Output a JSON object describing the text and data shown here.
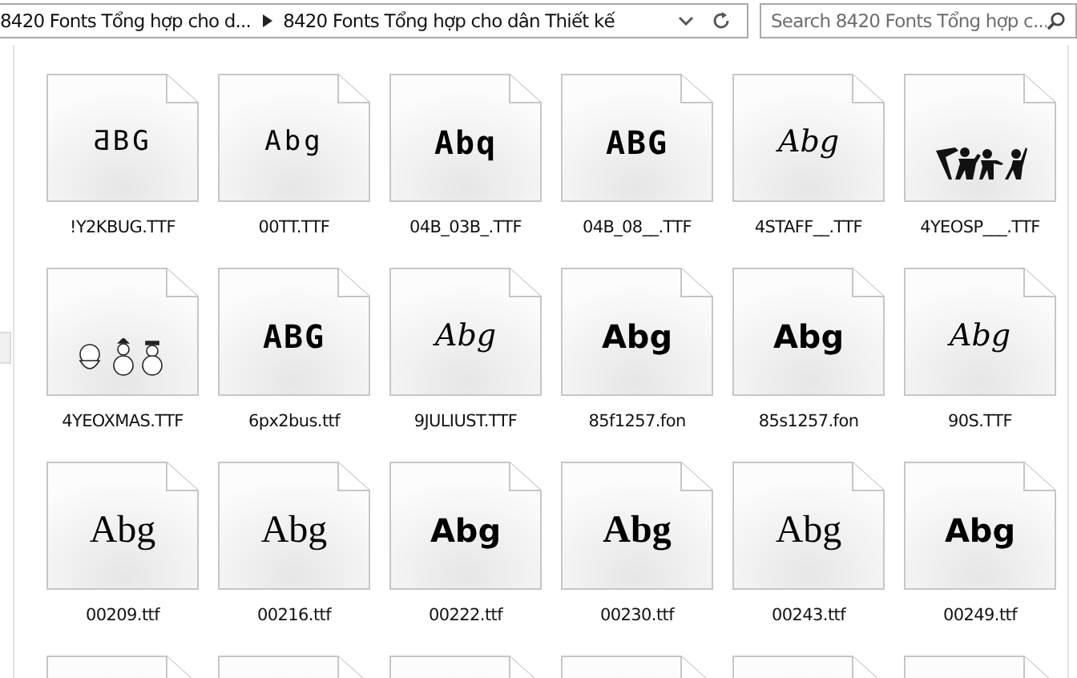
{
  "address_bar": {
    "breadcrumbs": [
      "8420 Fonts Tổng hợp cho d...",
      "8420 Fonts Tổng hợp cho dân Thiết kế"
    ]
  },
  "search": {
    "placeholder": "Search 8420 Fonts Tổng hợp c..."
  },
  "files": [
    {
      "name": "!Y2KBUG.TTF",
      "kind": "pixel",
      "preview": "ƋBG"
    },
    {
      "name": "00TT.TTF",
      "kind": "pixel",
      "preview": "Abg"
    },
    {
      "name": "04B_03B_.TTF",
      "kind": "blocky",
      "preview": "Abq"
    },
    {
      "name": "04B_08__.TTF",
      "kind": "blocky",
      "preview": "ABG"
    },
    {
      "name": "4STAFF__.TTF",
      "kind": "script",
      "preview": "Abg"
    },
    {
      "name": "4YEOSP___.TTF",
      "kind": "figures"
    },
    {
      "name": "4YEOXMAS.TTF",
      "kind": "snowmen"
    },
    {
      "name": "6px2bus.ttf",
      "kind": "blocky",
      "preview": "ABG"
    },
    {
      "name": "9JULIUST.TTF",
      "kind": "script",
      "preview": "Abg"
    },
    {
      "name": "85f1257.fon",
      "kind": "bold",
      "preview": "Abg"
    },
    {
      "name": "85s1257.fon",
      "kind": "bold",
      "preview": "Abg"
    },
    {
      "name": "90S.TTF",
      "kind": "script",
      "preview": "Abg"
    },
    {
      "name": "00209.ttf",
      "kind": "serif",
      "preview": "Abg"
    },
    {
      "name": "00216.ttf",
      "kind": "serif",
      "preview": "Abg"
    },
    {
      "name": "00222.ttf",
      "kind": "bold",
      "preview": "Abg"
    },
    {
      "name": "00230.ttf",
      "kind": "serifbold",
      "preview": "Abg"
    },
    {
      "name": "00243.ttf",
      "kind": "serif",
      "preview": "Abg"
    },
    {
      "name": "00249.ttf",
      "kind": "bold",
      "preview": "Abg"
    },
    {
      "kind": "partial"
    },
    {
      "kind": "partial"
    },
    {
      "kind": "partial"
    },
    {
      "kind": "partial"
    },
    {
      "kind": "partial"
    },
    {
      "kind": "partial"
    }
  ]
}
